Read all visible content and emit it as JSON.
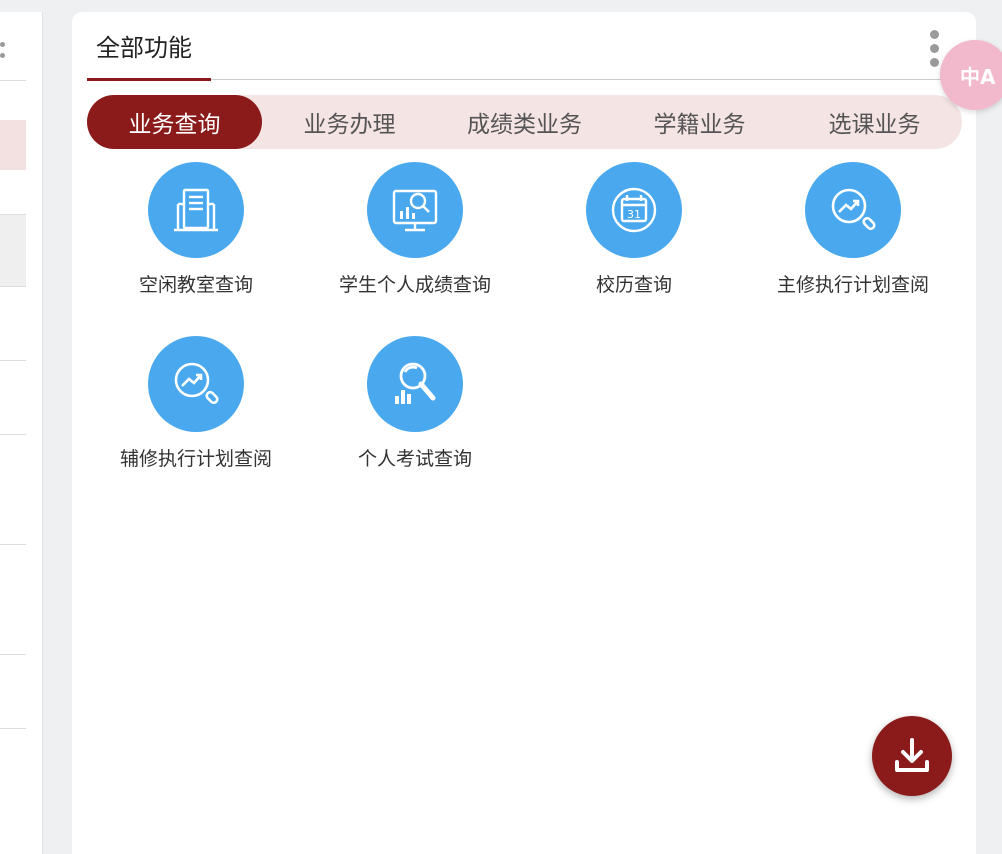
{
  "card": {
    "title": "全部功能"
  },
  "tabs": [
    {
      "label": "业务查询",
      "active": true
    },
    {
      "label": "业务办理",
      "active": false
    },
    {
      "label": "成绩类业务",
      "active": false
    },
    {
      "label": "学籍业务",
      "active": false
    },
    {
      "label": "选课业务",
      "active": false
    }
  ],
  "functions": [
    {
      "label": "空闲教室查询",
      "icon": "building-icon"
    },
    {
      "label": "学生个人成绩查询",
      "icon": "score-monitor-icon"
    },
    {
      "label": "校历查询",
      "icon": "calendar-icon"
    },
    {
      "label": "主修执行计划查阅",
      "icon": "trend-search-icon"
    },
    {
      "label": "辅修执行计划查阅",
      "icon": "trend-search-icon"
    },
    {
      "label": "个人考试查询",
      "icon": "magnifier-chart-icon"
    }
  ],
  "calendar_day": "31",
  "translate": {
    "label": "中A"
  },
  "colors": {
    "accent": "#8b1a1a",
    "icon_bg": "#4aa9ee",
    "tab_bg": "#f4e4e4"
  }
}
